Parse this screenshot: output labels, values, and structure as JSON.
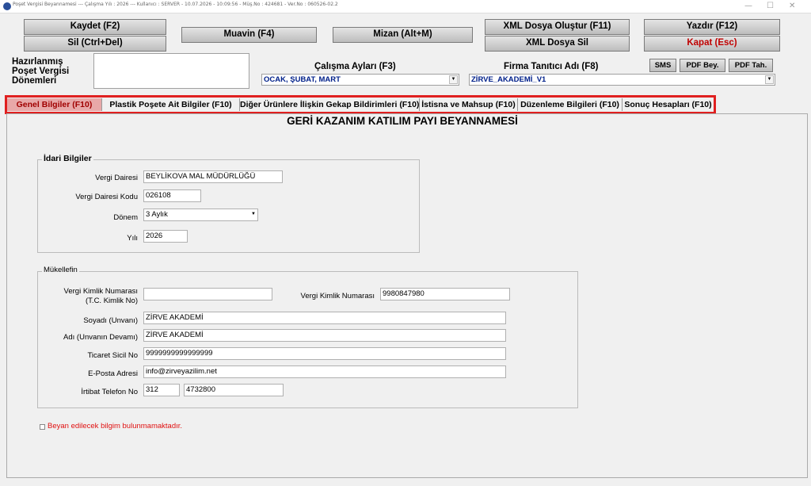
{
  "window": {
    "title": "Poşet Vergisi Beyannamesi --- Çalışma Yılı : 2026 --- Kullanıcı : SERVER - 10.07.2026 - 10:09:56 - Müş.No : 424681 - Ver.No : 060526-02.2",
    "minimize": "—",
    "maximize": "☐",
    "close": "✕"
  },
  "toolbar": {
    "save": "Kaydet (F2)",
    "delete": "Sil (Ctrl+Del)",
    "muavin": "Muavin (F4)",
    "mizan": "Mizan (Alt+M)",
    "xml_create": "XML Dosya Oluştur (F11)",
    "xml_delete": "XML Dosya Sil",
    "print": "Yazdır (F12)",
    "close": "Kapat (Esc)",
    "sms": "SMS",
    "pdf_bey": "PDF Bey.",
    "pdf_tah": "PDF Tah."
  },
  "prepared_periods": {
    "label_line1": "Hazırlanmış",
    "label_line2": "Poşet Vergisi",
    "label_line3": "Dönemleri"
  },
  "work_months": {
    "label": "Çalışma Ayları (F3)",
    "value": "OCAK, ŞUBAT, MART"
  },
  "firm": {
    "label": "Firma Tanıtıcı Adı (F8)",
    "value": "ZİRVE_AKADEMİ_V1"
  },
  "tabs": [
    {
      "label": "Genel Bilgiler (F10)",
      "active": true
    },
    {
      "label": "Plastik Poşete Ait Bilgiler (F10)"
    },
    {
      "label": "Diğer Ürünlere İlişkin Gekap Bildirimleri (F10)"
    },
    {
      "label": "İstisna ve Mahsup (F10)"
    },
    {
      "label": "Düzenleme Bilgileri (F10)"
    },
    {
      "label": "Sonuç Hesapları (F10)"
    }
  ],
  "form_title": "GERİ KAZANIM KATILIM PAYI BEYANNAMESİ",
  "idari": {
    "title": "İdari Bilgiler",
    "vergi_dairesi_label": "Vergi Dairesi",
    "vergi_dairesi": "BEYLİKOVA MAL MÜDÜRLÜĞÜ",
    "vergi_dairesi_kodu_label": "Vergi Dairesi Kodu",
    "vergi_dairesi_kodu": "026108",
    "donem_label": "Dönem",
    "donem": "3 Aylık",
    "yil_label": "Yılı",
    "yil": "2026"
  },
  "mukellef": {
    "title": "Mükellefin",
    "tckn_label1": "Vergi Kimlik Numarası",
    "tckn_label2": "(T.C. Kimlik No)",
    "tckn": "",
    "vkn_label": "Vergi Kimlik Numarası",
    "vkn": "9980847980",
    "soyadi_label": "Soyadı (Unvanı)",
    "soyadi": "ZİRVE AKADEMİ",
    "adi_label": "Adı (Unvanın Devamı)",
    "adi": "ZİRVE AKADEMİ",
    "ticaret_label": "Ticaret Sicil No",
    "ticaret": "9999999999999999",
    "eposta_label": "E-Posta Adresi",
    "eposta": "info@zirveyazilim.net",
    "telefon_label": "İrtibat Telefon No",
    "telefon_kod": "312",
    "telefon_no": "4732800"
  },
  "declaration_note": "Beyan edilecek bilgim bulunmamaktadır."
}
